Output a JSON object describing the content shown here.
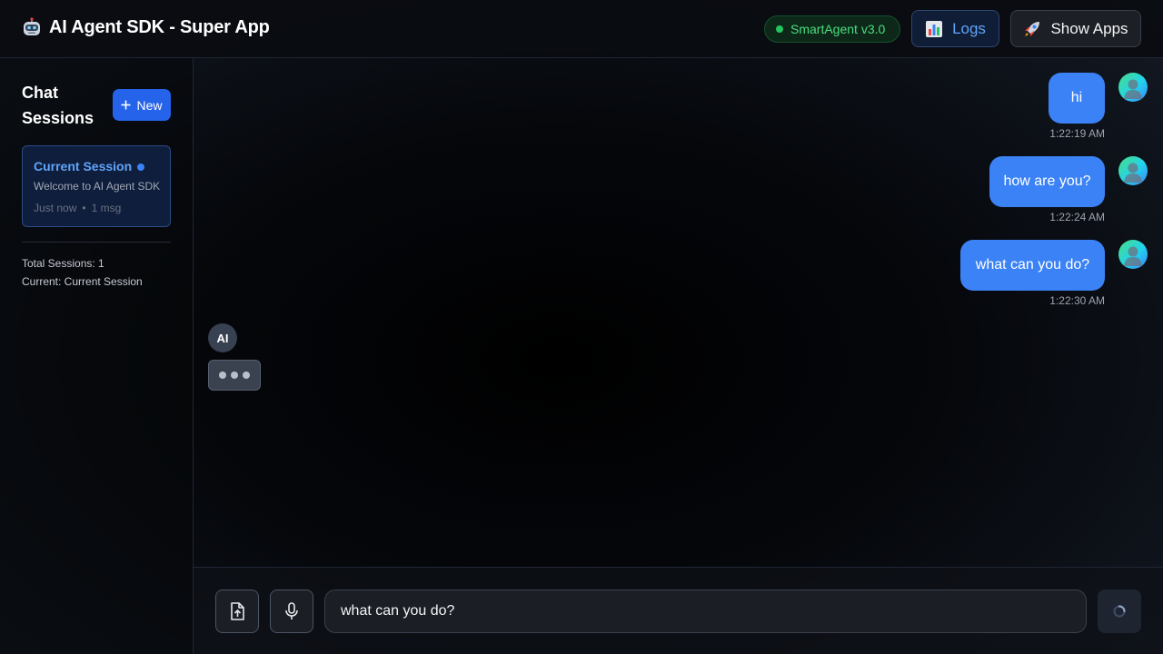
{
  "header": {
    "app_icon": "robot-icon",
    "title": "AI Agent SDK - Super App",
    "version_badge": "SmartAgent v3.0",
    "logs_icon": "bar-chart-icon",
    "logs_label": "Logs",
    "apps_icon": "rocket-icon",
    "apps_label": "Show Apps"
  },
  "sidebar": {
    "title": "Chat Sessions",
    "new_button_label": "New",
    "sessions": [
      {
        "name": "Current Session",
        "preview": "Welcome to AI Agent SDK",
        "time": "Just now",
        "separator": "•",
        "count": "1 msg",
        "active": true
      }
    ],
    "stats": {
      "total": "Total Sessions: 1",
      "current": "Current: Current Session"
    }
  },
  "chat": {
    "messages": [
      {
        "role": "user",
        "text": "hi",
        "time": "1:22:19 AM"
      },
      {
        "role": "user",
        "text": "how are you?",
        "time": "1:22:24 AM"
      },
      {
        "role": "user",
        "text": "what can you do?",
        "time": "1:22:30 AM"
      }
    ],
    "assistant_avatar": "AI",
    "assistant_typing": true
  },
  "composer": {
    "input_value": "what can you do?",
    "upload_icon": "file-upload-icon",
    "mic_icon": "microphone-icon",
    "send_icon": "loading-spinner-icon"
  },
  "colors": {
    "accent": "#3b82f6",
    "primary_button": "#2563eb",
    "status_green": "#22c55e",
    "logs_text": "#60a5fa"
  }
}
